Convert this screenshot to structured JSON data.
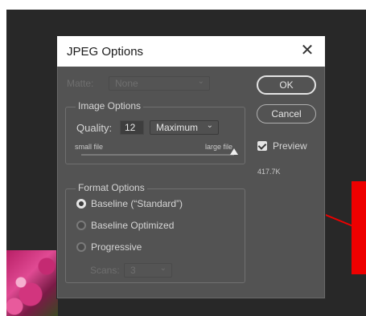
{
  "dialog": {
    "title": "JPEG Options",
    "close_glyph": "✕",
    "matte": {
      "label": "Matte:",
      "value": "None"
    },
    "image_options": {
      "title": "Image Options",
      "quality_label": "Quality:",
      "quality_value": "12",
      "quality_preset": "Maximum",
      "small_file_label": "small file",
      "large_file_label": "large file",
      "slider_fraction": 1.0
    },
    "format_options": {
      "title": "Format Options",
      "options": [
        {
          "label": "Baseline (“Standard”)",
          "selected": true
        },
        {
          "label": "Baseline Optimized",
          "selected": false
        },
        {
          "label": "Progressive",
          "selected": false
        }
      ],
      "scans_label": "Scans:",
      "scans_value": "3"
    },
    "ok_label": "OK",
    "cancel_label": "Cancel",
    "preview_label": "Preview",
    "preview_checked": true,
    "file_size": "417.7K"
  },
  "colors": {
    "dialog_bg": "#535353",
    "backdrop": "#282828",
    "annotation_red": "#ee0000"
  },
  "icons": {
    "close": "close-icon",
    "chevron": "chevron-down-icon",
    "check": "checkmark-icon"
  }
}
